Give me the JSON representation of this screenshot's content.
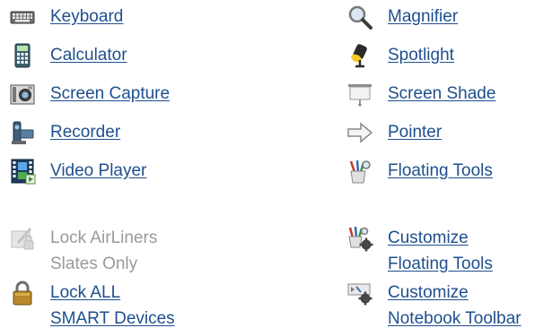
{
  "tools_left": [
    {
      "id": "keyboard",
      "label": "Keyboard",
      "icon": "keyboard-icon"
    },
    {
      "id": "calculator",
      "label": "Calculator",
      "icon": "calculator-icon"
    },
    {
      "id": "screen-capture",
      "label": "Screen Capture",
      "icon": "camera-icon"
    },
    {
      "id": "recorder",
      "label": "Recorder",
      "icon": "video-camera-icon"
    },
    {
      "id": "video-player",
      "label": "Video Player",
      "icon": "film-strip-icon"
    }
  ],
  "tools_right": [
    {
      "id": "magnifier",
      "label": "Magnifier",
      "icon": "magnifier-icon"
    },
    {
      "id": "spotlight",
      "label": "Spotlight",
      "icon": "spotlight-icon"
    },
    {
      "id": "screen-shade",
      "label": "Screen Shade",
      "icon": "screen-shade-icon"
    },
    {
      "id": "pointer",
      "label": "Pointer",
      "icon": "arrow-icon"
    },
    {
      "id": "floating-tools",
      "label": "Floating Tools",
      "icon": "pen-cup-icon"
    }
  ],
  "lock_airliners": {
    "line1": "Lock AirLiners",
    "line2": "Slates Only",
    "icon": "slate-lock-icon",
    "color": "#9a9a9a"
  },
  "lock_all": {
    "line1": "Lock ALL",
    "line2": "SMART Devices",
    "icon": "padlock-icon"
  },
  "customize_floating": {
    "line1": "Customize",
    "line2": "Floating Tools",
    "icon": "pen-cup-gear-icon"
  },
  "customize_notebook": {
    "line1": "Customize",
    "line2": "Notebook Toolbar",
    "icon": "toolbar-gear-icon"
  },
  "colors": {
    "link": "#1f4f8e",
    "disabled": "#9a9a9a"
  }
}
